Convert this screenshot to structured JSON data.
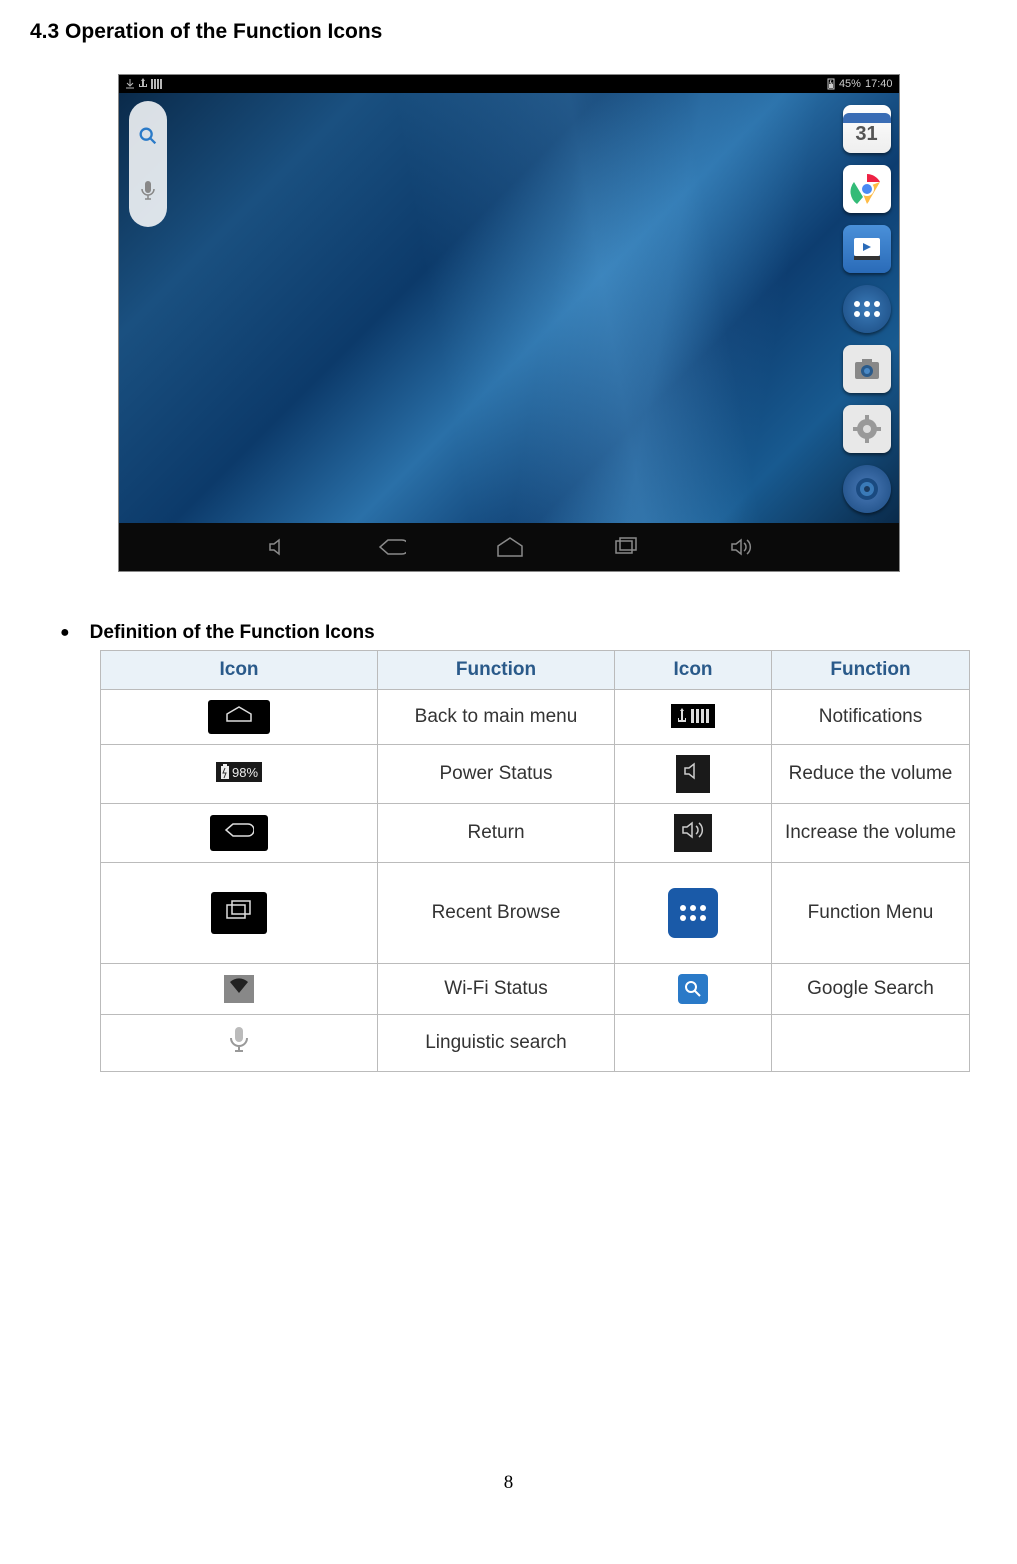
{
  "section_title": "4.3 Operation of the Function Icons",
  "screenshot": {
    "status_battery": "45%",
    "status_time": "17:40",
    "calendar_day": "31"
  },
  "sub_heading": "Definition of the Function Icons",
  "table": {
    "headers": {
      "icon1": "Icon",
      "func1": "Function",
      "icon2": "Icon",
      "func2": "Function"
    },
    "rows": [
      {
        "f1": "Back to main menu",
        "f2": "Notifications"
      },
      {
        "f1": "Power Status",
        "f2": "Reduce the volume",
        "batt": "98%"
      },
      {
        "f1": "Return",
        "f2": "Increase the volume"
      },
      {
        "f1": "Recent Browse",
        "f2": "Function Menu"
      },
      {
        "f1": "Wi-Fi Status",
        "f2": "Google Search"
      },
      {
        "f1": "Linguistic search",
        "f2": ""
      }
    ]
  },
  "page_number": "8"
}
